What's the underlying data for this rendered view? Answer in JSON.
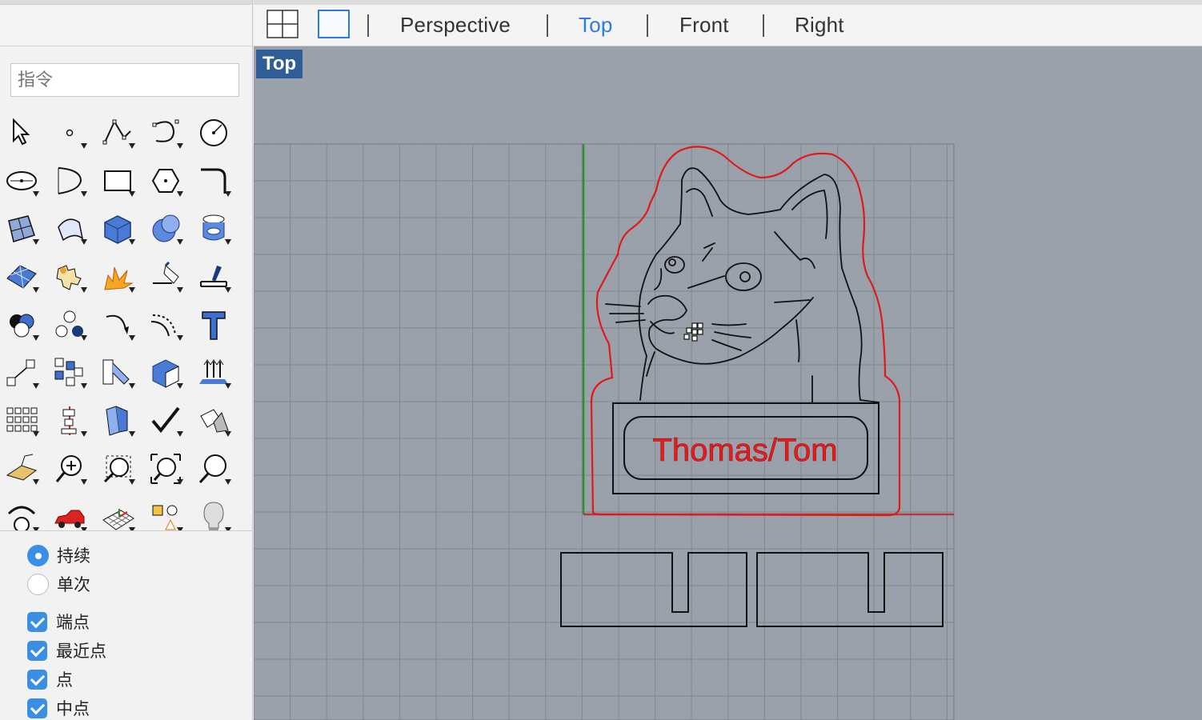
{
  "sidebar": {
    "command_placeholder": "指令",
    "osnap_mode": [
      {
        "label": "持续",
        "selected": true
      },
      {
        "label": "单次",
        "selected": false
      }
    ],
    "osnaps": [
      {
        "label": "端点",
        "checked": true
      },
      {
        "label": "最近点",
        "checked": true
      },
      {
        "label": "点",
        "checked": true
      },
      {
        "label": "中点",
        "checked": true
      }
    ]
  },
  "tabs": {
    "perspective": "Perspective",
    "top": "Top",
    "front": "Front",
    "right": "Right"
  },
  "viewport": {
    "label": "Top",
    "name_text": "Thomas/Tom"
  },
  "colors": {
    "accent": "#2c7be5",
    "viewport_bg": "#9aa1aa",
    "grid_line": "#8a9099",
    "x_axis": "#c43030",
    "y_axis": "#2e8b2e",
    "curve_red": "#e01a1a",
    "curve_black": "#111111"
  },
  "tool_icons": [
    "select-arrow-icon",
    "point-icon",
    "polyline-icon",
    "curve-icon",
    "circle-icon",
    "ellipse-icon",
    "arc-icon",
    "rectangle-icon",
    "polygon-icon",
    "fillet-curve-icon",
    "surface-from-points-icon",
    "surface-icon",
    "box-icon",
    "sphere-icon",
    "cylinder-icon",
    "mesh-icon",
    "extrude-puzzle-icon",
    "explode-icon",
    "trim-icon",
    "split-icon",
    "boolean-union-icon",
    "boolean-group-icon",
    "offset-curve-icon",
    "offset-arc-icon",
    "text-icon",
    "scale-icon",
    "array-icon",
    "transform-icon",
    "solid-edit-icon",
    "flow-icon",
    "array-grid-icon",
    "align-icon",
    "shell-icon",
    "check-icon",
    "render-mesh-icon",
    "analyze-icon",
    "zoom-in-icon",
    "zoom-window-icon",
    "zoom-extents-icon",
    "zoom-icon",
    "rotate-view-icon",
    "car-render-icon",
    "grid-plane-icon",
    "shape-icon",
    "light-bulb-icon"
  ]
}
